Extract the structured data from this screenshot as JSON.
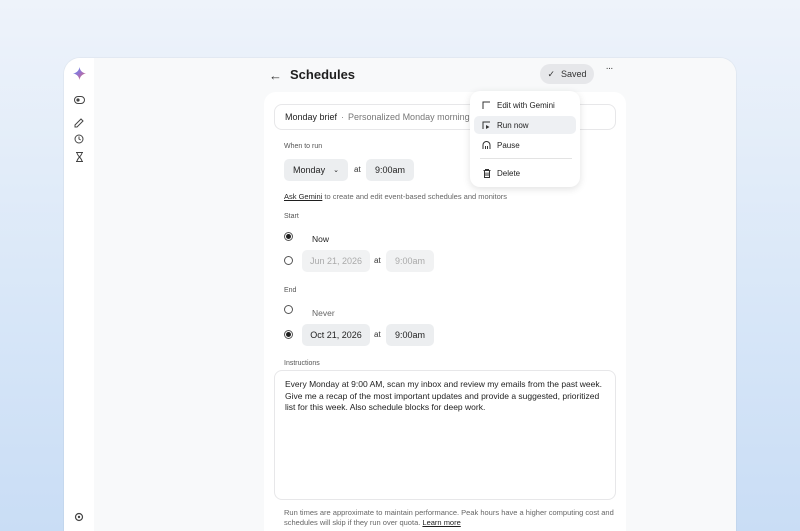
{
  "header": {
    "title": "Schedules",
    "back_icon": "arrow-left-icon",
    "saved_label": "Saved",
    "more_icon": "more-horizontal-icon"
  },
  "sidebar": {
    "logo": "gemini-sparkle-icon",
    "items": [
      {
        "icon": "toggle-icon"
      },
      {
        "icon": "edit-icon"
      },
      {
        "icon": "history-icon"
      },
      {
        "icon": "hourglass-icon"
      },
      {
        "icon": "settings-icon"
      }
    ]
  },
  "schedule": {
    "name": "Monday brief",
    "separator": "·",
    "description": "Personalized Monday morning brief",
    "when_to_run_label": "When to run",
    "day_value": "Monday",
    "at_label": "at",
    "time_value": "9:00am",
    "hint_link": "Ask Gemini",
    "hint_text": " to create and edit event-based schedules and monitors",
    "start": {
      "label": "Start",
      "now_label": "Now",
      "date_placeholder": "Jun 21, 2026",
      "time_placeholder": "9:00am"
    },
    "end": {
      "label": "End",
      "never_label": "Never",
      "date_value": "Oct 21, 2026",
      "time_value": "9:00am"
    },
    "instructions_label": "Instructions",
    "instructions_text": "Every Monday at 9:00 AM, scan my inbox and review my emails from the past week. Give me a recap of the most important updates and provide a suggested, prioritized list for this week. Also schedule blocks for deep work.",
    "footer_text": "Run times are approximate to maintain performance. Peak hours have a higher computing cost and schedules will skip if they run over quota.",
    "footer_link": "Learn more"
  },
  "menu": {
    "items": [
      {
        "label": "Edit with Gemini",
        "icon": "edit-box-icon"
      },
      {
        "label": "Run now",
        "icon": "run-icon"
      },
      {
        "label": "Pause",
        "icon": "pause-icon"
      },
      {
        "label": "Delete",
        "icon": "trash-icon"
      }
    ]
  },
  "colors": {
    "background_top": "#eef3fa",
    "background_bottom": "#c9ddf5",
    "selected_radio": "#1f1f1f"
  }
}
